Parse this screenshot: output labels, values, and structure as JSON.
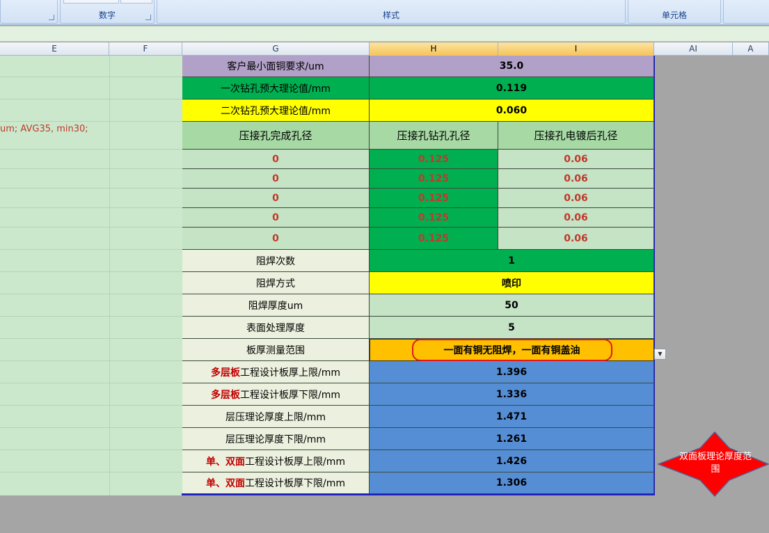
{
  "ribbon": {
    "groups": [
      {
        "label": "",
        "has_launcher": true
      },
      {
        "label": "数字",
        "has_launcher": true
      },
      {
        "label": "样式",
        "has_launcher": false
      },
      {
        "label": "单元格",
        "has_launcher": false
      },
      {
        "label": "",
        "has_launcher": false
      }
    ]
  },
  "columns": [
    "E",
    "F",
    "G",
    "H",
    "I",
    "AI",
    "A"
  ],
  "left_note": "um; AVG35, min30;",
  "table": {
    "customer_copper": {
      "label": "客户最小面铜要求/um",
      "value": "35.0"
    },
    "first_drill": {
      "label": "一次钻孔预大理论值/mm",
      "value": "0.119"
    },
    "second_drill": {
      "label": "二次钻孔预大理论值/mm",
      "value": "0.060"
    },
    "press_header": [
      "压接孔完成孔径",
      "压接孔钻孔孔径",
      "压接孔电镀后孔径"
    ],
    "press_rows": [
      [
        "0",
        "0.125",
        "0.06"
      ],
      [
        "0",
        "0.125",
        "0.06"
      ],
      [
        "0",
        "0.125",
        "0.06"
      ],
      [
        "0",
        "0.125",
        "0.06"
      ],
      [
        "0",
        "0.125",
        "0.06"
      ]
    ],
    "mask_count": {
      "label": "阻焊次数",
      "value": "1"
    },
    "mask_method": {
      "label": "阻焊方式",
      "value": "喷印"
    },
    "mask_thickness": {
      "label": "阻焊厚度um",
      "value": "50"
    },
    "surface_thickness": {
      "label": "表面处理厚度",
      "value": "5"
    },
    "board_range": {
      "label": "板厚测量范围",
      "value": "一面有铜无阻焊，一面有铜盖油"
    },
    "ml_upper": {
      "prefix": "多层板",
      "label": "工程设计板厚上限/mm",
      "value": "1.396"
    },
    "ml_lower": {
      "prefix": "多层板",
      "label": "工程设计板厚下限/mm",
      "value": "1.336"
    },
    "lam_upper": {
      "label": "层压理论厚度上限/mm",
      "value": "1.471"
    },
    "lam_lower": {
      "label": "层压理论厚度下限/mm",
      "value": "1.261"
    },
    "sd_upper": {
      "prefix": "单、双面",
      "label": "工程设计板厚上限/mm",
      "value": "1.426"
    },
    "sd_lower": {
      "prefix": "单、双面",
      "label": "工程设计板厚下限/mm",
      "value": "1.306"
    }
  },
  "star_shape": {
    "text": "双面板理论厚度范围",
    "fill": "#ff0000",
    "text_color": "#ffffff"
  },
  "colors": {
    "lavender": "#b1a0c7",
    "green": "#00b050",
    "yellow": "#ffff00",
    "light_green": "#c5e3c5",
    "header_green": "#a6d9a4",
    "label_bg": "#ebf1de",
    "orange": "#ffc000",
    "blue": "#558ed5"
  }
}
